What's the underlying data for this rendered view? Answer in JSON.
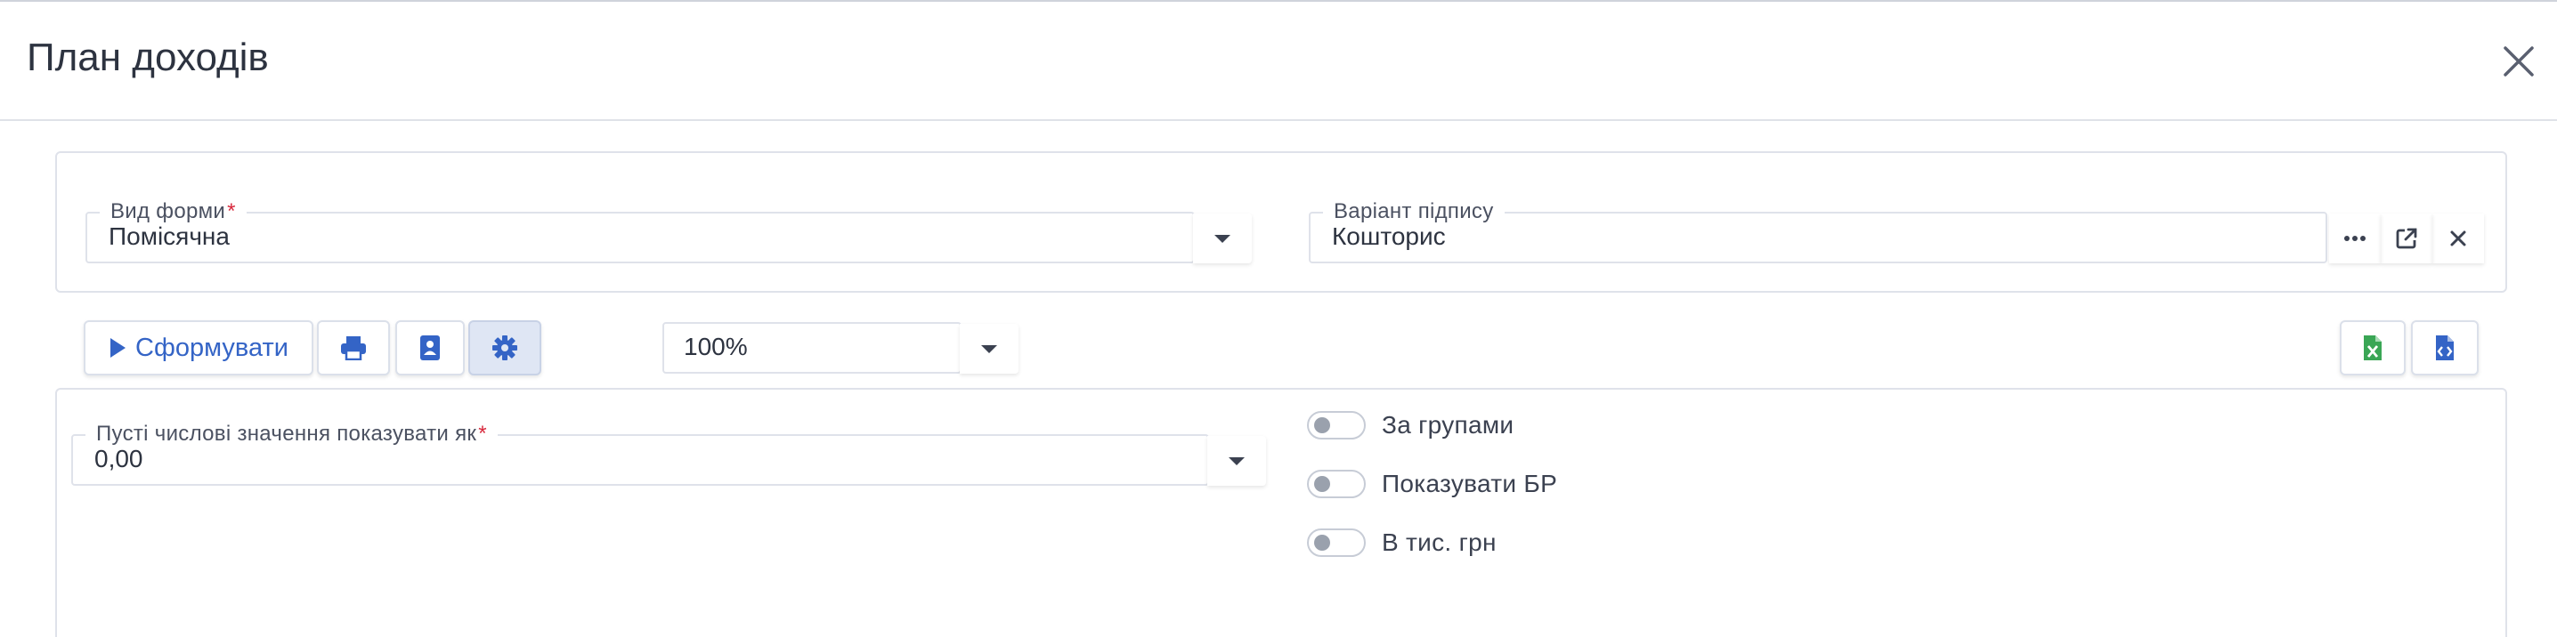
{
  "dialog": {
    "title": "План доходів",
    "close_icon": "close-icon"
  },
  "form": {
    "form_type": {
      "label": "Вид форми",
      "required_mark": "*",
      "value": "Помісячна"
    },
    "signature": {
      "label": "Варіант підпису",
      "value": "Кошторис",
      "actions": [
        "more-icon",
        "external-link-icon",
        "clear-icon"
      ]
    }
  },
  "toolbar": {
    "generate_label": "Сформувати",
    "zoom_value": "100%",
    "icons": {
      "print": "print-icon",
      "contact": "contact-card-icon",
      "settings": "gear-icon",
      "excel": "excel-file-icon",
      "code": "code-file-icon"
    }
  },
  "settings": {
    "empty_values": {
      "label": "Пусті числові значення показувати як",
      "required_mark": "*",
      "value": "0,00"
    },
    "toggles": [
      {
        "label": "За групами",
        "on": false
      },
      {
        "label": "Показувати БР",
        "on": false
      },
      {
        "label": "В тис. грн",
        "on": false
      }
    ]
  },
  "colors": {
    "accent": "#3464c6",
    "required": "#d8283c",
    "excel": "#3aa655"
  }
}
